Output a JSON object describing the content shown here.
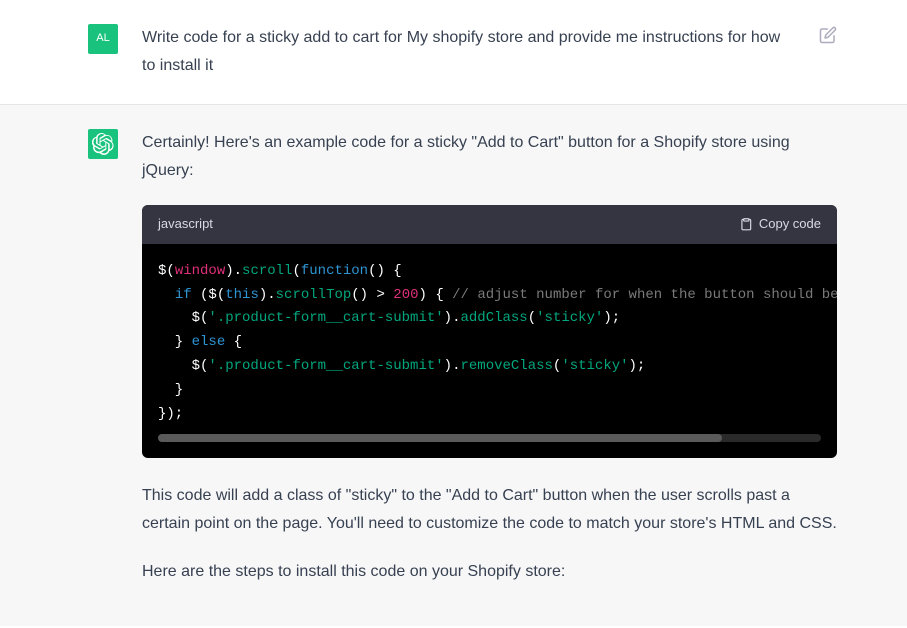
{
  "user": {
    "avatar_initials": "AL",
    "message": "Write code for a sticky add to cart for My shopify store and provide me instructions for how to install it"
  },
  "assistant": {
    "intro": "Certainly! Here's an example code for a sticky \"Add to Cart\" button for a Shopify store using jQuery:",
    "code_language": "javascript",
    "copy_label": "Copy code",
    "code": {
      "line1": {
        "t1": "$",
        "t2": "(",
        "t3": "window",
        "t4": ").",
        "t5": "scroll",
        "t6": "(",
        "t7": "function",
        "t8": "(",
        "t9": ") {"
      },
      "line2": {
        "t1": "  ",
        "t2": "if",
        "t3": " ($(",
        "t4": "this",
        "t5": ").",
        "t6": "scrollTop",
        "t7": "() > ",
        "t8": "200",
        "t9": ") { ",
        "t10": "// adjust number for when the button should become sticky"
      },
      "line3": {
        "t1": "    $(",
        "t2": "'.product-form__cart-submit'",
        "t3": ").",
        "t4": "addClass",
        "t5": "(",
        "t6": "'sticky'",
        "t7": ");"
      },
      "line4": {
        "t1": "  } ",
        "t2": "else",
        "t3": " {"
      },
      "line5": {
        "t1": "    $(",
        "t2": "'.product-form__cart-submit'",
        "t3": ").",
        "t4": "removeClass",
        "t5": "(",
        "t6": "'sticky'",
        "t7": ");"
      },
      "line6": "  }",
      "line7": "});"
    },
    "explanation": "This code will add a class of \"sticky\" to the \"Add to Cart\" button when the user scrolls past a certain point on the page. You'll need to customize the code to match your store's HTML and CSS.",
    "steps_intro": "Here are the steps to install this code on your Shopify store:"
  }
}
